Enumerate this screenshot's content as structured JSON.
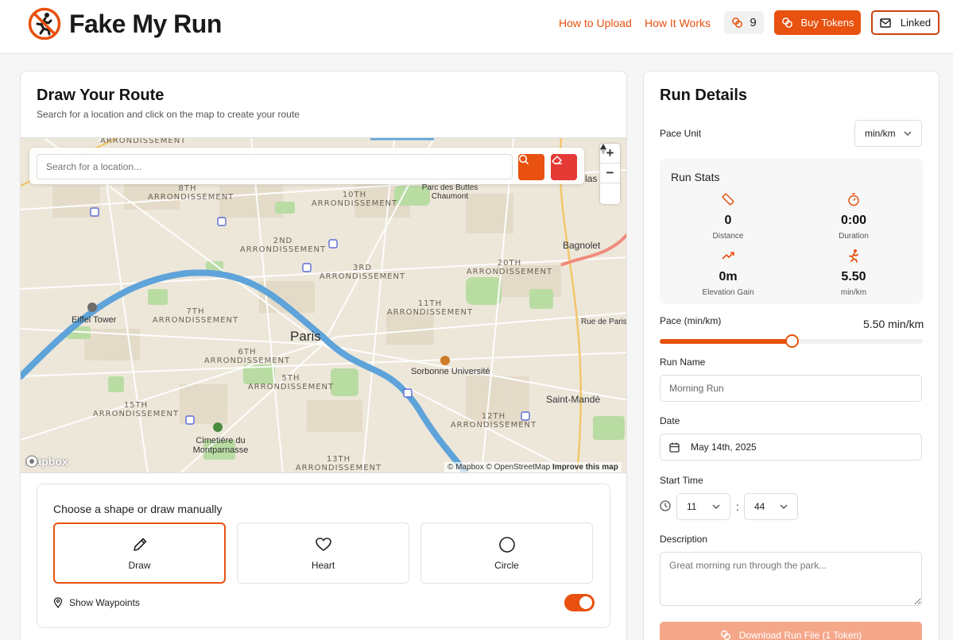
{
  "header": {
    "brand": "Fake My Run",
    "nav": {
      "how_to_upload": "How to Upload",
      "how_it_works": "How It Works"
    },
    "token_count": "9",
    "buy_tokens": "Buy Tokens",
    "linked": "Linked"
  },
  "route": {
    "title": "Draw Your Route",
    "subtitle": "Search for a location and click on the map to create your route",
    "search_placeholder": "Search for a location...",
    "map": {
      "city": "Paris",
      "places": {
        "eiffel": "Eiffel Tower",
        "sorbonne": "Sorbonne Université",
        "cimetiere": "Cimetière du Montparnasse",
        "bagnolet": "Bagnolet",
        "saint_mande": "Saint-Mandé",
        "buttes": "Parc des Buttes Chaumont",
        "rue_paris": "Rue de Paris",
        "lilas": "las"
      },
      "districts": {
        "a1": "ARRONDISSEMENT",
        "a8": "8TH ARRONDISSEMENT",
        "a10": "10TH ARRONDISSEMENT",
        "a2": "2ND ARRONDISSEMENT",
        "a3": "3RD ARRONDISSEMENT",
        "a20": "20TH ARRONDISSEMENT",
        "a7": "7TH ARRONDISSEMENT",
        "a11": "11TH ARRONDISSEMENT",
        "a6": "6TH ARRONDISSEMENT",
        "a5": "5TH ARRONDISSEMENT",
        "a15": "15TH ARRONDISSEMENT",
        "a12": "12TH ARRONDISSEMENT",
        "a13": "13TH ARRONDISSEMENT"
      },
      "attribution": "© Mapbox © OpenStreetMap",
      "improve": "Improve this map",
      "logo": "mapbox"
    },
    "shapes_title": "Choose a shape or draw manually",
    "shapes": [
      "Draw",
      "Heart",
      "Circle"
    ],
    "waypoints": "Show Waypoints",
    "waypoints_on": true
  },
  "details": {
    "title": "Run Details",
    "pace_unit_label": "Pace Unit",
    "pace_unit_value": "min/km",
    "stats_title": "Run Stats",
    "stats": {
      "distance": {
        "value": "0",
        "label": "Distance"
      },
      "duration": {
        "value": "0:00",
        "label": "Duration"
      },
      "elevation": {
        "value": "0m",
        "label": "Elevation Gain"
      },
      "pace": {
        "value": "5.50",
        "label": "min/km"
      }
    },
    "pace_label": "Pace (min/km)",
    "pace_value": "5.50 min/km",
    "pace_fraction": 0.5,
    "run_name_label": "Run Name",
    "run_name_placeholder": "Morning Run",
    "date_label": "Date",
    "date_value": "May 14th, 2025",
    "start_time_label": "Start Time",
    "hour": "11",
    "time_sep": ":",
    "minute": "44",
    "description_label": "Description",
    "description_placeholder": "Great morning run through the park...",
    "download": "Download Run File (1 Token)"
  },
  "colors": {
    "accent": "#e8510f",
    "danger": "#e53935",
    "river": "#5ea3d9",
    "park": "#b6dba0"
  }
}
